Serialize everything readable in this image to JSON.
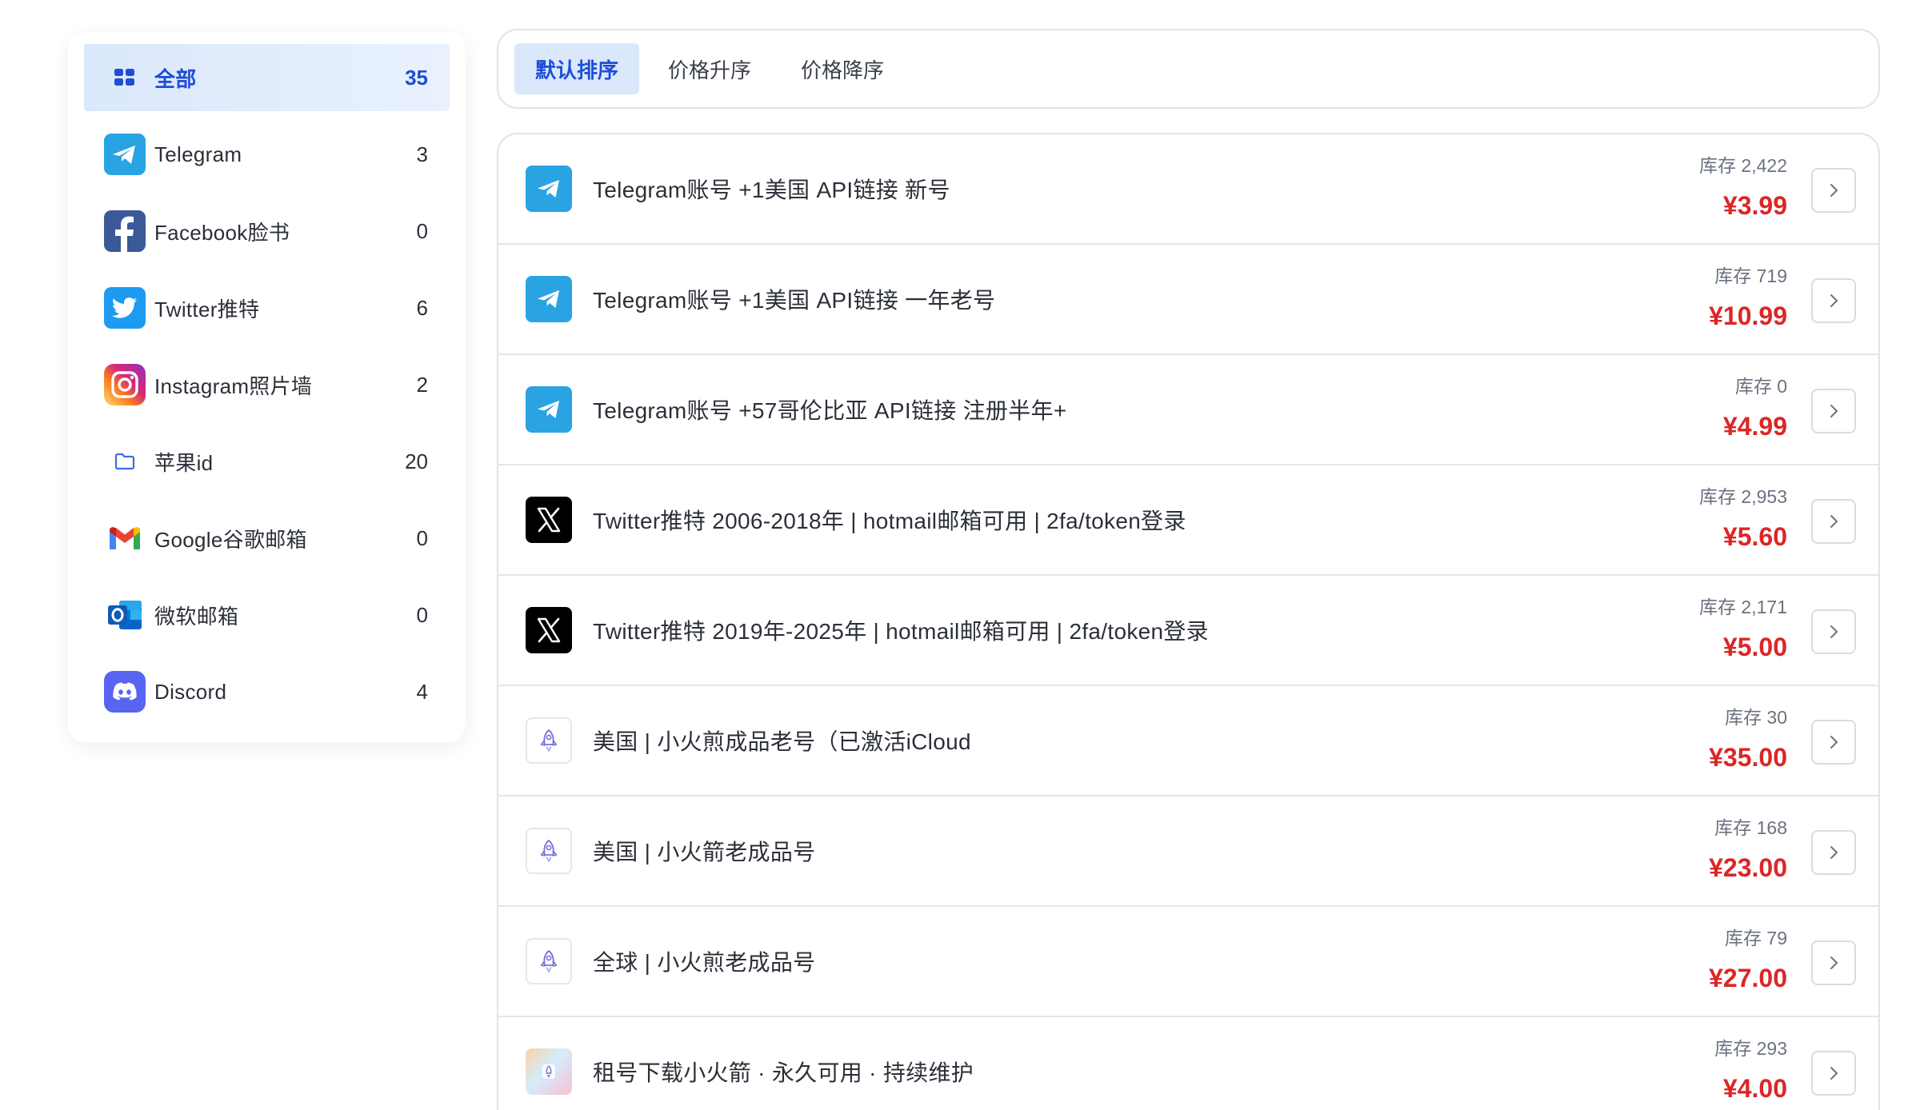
{
  "sidebar": {
    "items": [
      {
        "label": "全部",
        "count": "35",
        "icon": "grid-icon"
      },
      {
        "label": "Telegram",
        "count": "3",
        "icon": "telegram-icon"
      },
      {
        "label": "Facebook脸书",
        "count": "0",
        "icon": "facebook-icon"
      },
      {
        "label": "Twitter推特",
        "count": "6",
        "icon": "twitter-icon"
      },
      {
        "label": "Instagram照片墙",
        "count": "2",
        "icon": "instagram-icon"
      },
      {
        "label": "苹果id",
        "count": "20",
        "icon": "folder-icon"
      },
      {
        "label": "Google谷歌邮箱",
        "count": "0",
        "icon": "gmail-icon"
      },
      {
        "label": "微软邮箱",
        "count": "0",
        "icon": "outlook-icon"
      },
      {
        "label": "Discord",
        "count": "4",
        "icon": "discord-icon"
      }
    ]
  },
  "sort": {
    "tabs": [
      {
        "label": "默认排序",
        "active": true
      },
      {
        "label": "价格升序",
        "active": false
      },
      {
        "label": "价格降序",
        "active": false
      }
    ]
  },
  "products": [
    {
      "icon": "telegram-icon",
      "title": "Telegram账号 +1美国 API链接 新号",
      "stock": "库存 2,422",
      "price": "¥3.99"
    },
    {
      "icon": "telegram-icon",
      "title": "Telegram账号 +1美国 API链接 一年老号",
      "stock": "库存 719",
      "price": "¥10.99"
    },
    {
      "icon": "telegram-icon",
      "title": "Telegram账号 +57哥伦比亚 API链接 注册半年+",
      "stock": "库存 0",
      "price": "¥4.99"
    },
    {
      "icon": "x-logo-icon",
      "title": "Twitter推特 2006-2018年 | hotmail邮箱可用 | 2fa/token登录",
      "stock": "库存 2,953",
      "price": "¥5.60"
    },
    {
      "icon": "x-logo-icon",
      "title": "Twitter推特 2019年-2025年 | hotmail邮箱可用 | 2fa/token登录",
      "stock": "库存 2,171",
      "price": "¥5.00"
    },
    {
      "icon": "rocket-icon",
      "title": "美国 | 小火煎成品老号（已激活iCloud",
      "stock": "库存 30",
      "price": "¥35.00"
    },
    {
      "icon": "rocket-icon",
      "title": "美国 | 小火箭老成品号",
      "stock": "库存 168",
      "price": "¥23.00"
    },
    {
      "icon": "rocket-icon",
      "title": "全球 | 小火煎老成品号",
      "stock": "库存 79",
      "price": "¥27.00"
    },
    {
      "icon": "rocket-app-icon",
      "title": "租号下载小火箭 · 永久可用 · 持续维护",
      "stock": "库存 293",
      "price": "¥4.00"
    }
  ],
  "colors": {
    "accent": "#1d4ed8",
    "active_bg": "#dbe8fb",
    "price": "#dc2626",
    "telegram": "#2aa3e3",
    "facebook": "#3b5998",
    "twitter": "#1d9bf0",
    "discord": "#5865f2"
  }
}
